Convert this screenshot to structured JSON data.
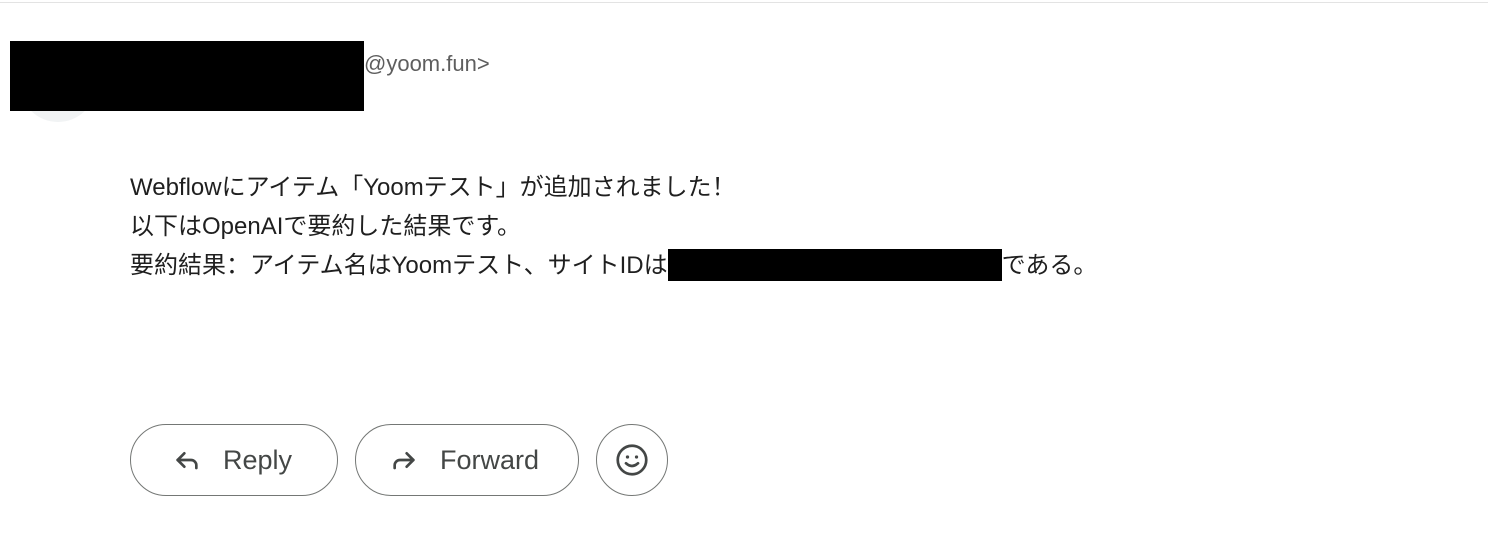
{
  "sender": {
    "email_domain": "@yoom.fun>"
  },
  "message": {
    "lines": [
      "Webflowにアイテム「Yoomテスト」が追加されました！",
      "以下はOpenAIで要約した結果です。"
    ],
    "summary_prefix": "要約結果：アイテム名はYoomテスト、サイトIDは",
    "summary_suffix": "である。"
  },
  "actions": {
    "reply_label": "Reply",
    "forward_label": "Forward"
  },
  "icons": {
    "reply": "reply-arrow-icon",
    "forward": "forward-arrow-icon",
    "emoji": "smiley-emoji-icon"
  },
  "colors": {
    "text": "#1f1f1f",
    "secondary_text": "#5e5e5e",
    "button_border": "#747775",
    "button_text": "#444746"
  }
}
